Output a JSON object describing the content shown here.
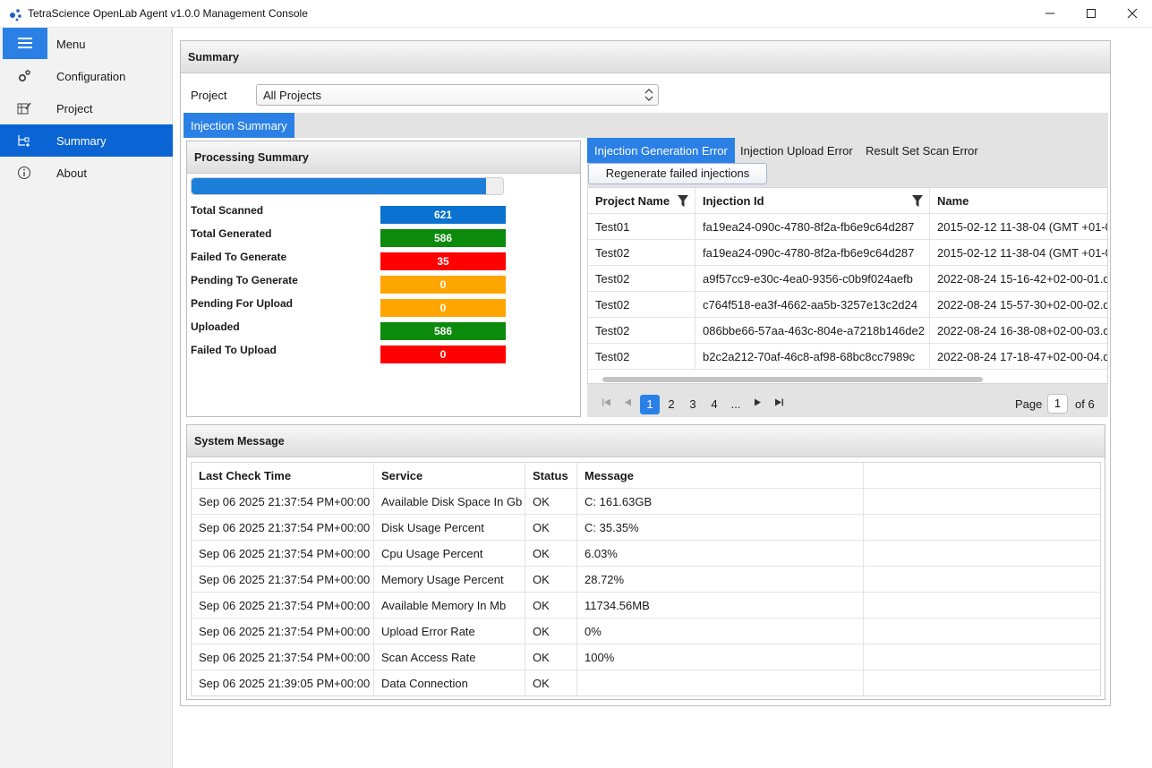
{
  "window": {
    "title": "TetraScience OpenLab Agent v1.0.0 Management Console"
  },
  "sidebar": {
    "items": [
      {
        "label": "Menu",
        "icon": "hamburger-menu-icon"
      },
      {
        "label": "Configuration",
        "icon": "gears-icon"
      },
      {
        "label": "Project",
        "icon": "edit-grid-icon"
      },
      {
        "label": "Summary",
        "icon": "summary-tree-icon",
        "active": true
      },
      {
        "label": "About",
        "icon": "info-icon"
      }
    ]
  },
  "summary": {
    "title": "Summary",
    "project_label": "Project",
    "project_value": "All Projects",
    "tab": "Injection Summary"
  },
  "processing": {
    "title": "Processing Summary",
    "progress_fraction": 0.945,
    "stats": [
      {
        "label": "Total Scanned",
        "value": "621",
        "color": "#0a72d0"
      },
      {
        "label": "Total Generated",
        "value": "586",
        "color": "#0b8a0b"
      },
      {
        "label": "Failed To Generate",
        "value": "35",
        "color": "#ff0000"
      },
      {
        "label": "Pending To Generate",
        "value": "0",
        "color": "#ffa500"
      },
      {
        "label": "Pending For Upload",
        "value": "0",
        "color": "#ffa500"
      },
      {
        "label": "Uploaded",
        "value": "586",
        "color": "#0b8a0b"
      },
      {
        "label": "Failed To Upload",
        "value": "0",
        "color": "#ff0000"
      }
    ]
  },
  "errors": {
    "tabs": [
      "Injection Generation Error",
      "Injection Upload Error",
      "Result Set Scan Error"
    ],
    "regenerate_label": "Regenerate failed injections",
    "columns": [
      "Project Name",
      "Injection Id",
      "Name"
    ],
    "rows": [
      [
        "Test01",
        "fa19ea24-090c-4780-8f2a-fb6e9c64d287",
        "2015-02-12 11-38-04 (GMT +01-0"
      ],
      [
        "Test02",
        "fa19ea24-090c-4780-8f2a-fb6e9c64d287",
        "2015-02-12 11-38-04 (GMT +01-0"
      ],
      [
        "Test02",
        "a9f57cc9-e30c-4ea0-9356-c0b9f024aefb",
        "2022-08-24 15-16-42+02-00-01.d"
      ],
      [
        "Test02",
        "c764f518-ea3f-4662-aa5b-3257e13c2d24",
        "2022-08-24 15-57-30+02-00-02.d"
      ],
      [
        "Test02",
        "086bbe66-57aa-463c-804e-a7218b146de2",
        "2022-08-24 16-38-08+02-00-03.d"
      ],
      [
        "Test02",
        "b2c2a212-70af-46c8-af98-68bc8cc7989c",
        "2022-08-24 17-18-47+02-00-04.d"
      ]
    ],
    "pager": {
      "pages": [
        "1",
        "2",
        "3",
        "4",
        "..."
      ],
      "current": "1",
      "page_label": "Page",
      "page_input": "1",
      "of_label": "of 6"
    }
  },
  "system": {
    "title": "System Message",
    "columns": [
      "Last Check Time",
      "Service",
      "Status",
      "Message",
      ""
    ],
    "rows": [
      [
        "Sep 06 2025 21:37:54 PM+00:00",
        "Available Disk Space In Gb",
        "OK",
        "C: 161.63GB",
        ""
      ],
      [
        "Sep 06 2025 21:37:54 PM+00:00",
        "Disk Usage Percent",
        "OK",
        "C: 35.35%",
        ""
      ],
      [
        "Sep 06 2025 21:37:54 PM+00:00",
        "Cpu Usage Percent",
        "OK",
        "6.03%",
        ""
      ],
      [
        "Sep 06 2025 21:37:54 PM+00:00",
        "Memory Usage Percent",
        "OK",
        "28.72%",
        ""
      ],
      [
        "Sep 06 2025 21:37:54 PM+00:00",
        "Available Memory In Mb",
        "OK",
        "11734.56MB",
        ""
      ],
      [
        "Sep 06 2025 21:37:54 PM+00:00",
        "Upload Error Rate",
        "OK",
        "0%",
        ""
      ],
      [
        "Sep 06 2025 21:37:54 PM+00:00",
        "Scan Access Rate",
        "OK",
        "100%",
        ""
      ],
      [
        "Sep 06 2025 21:39:05 PM+00:00",
        "Data Connection",
        "OK",
        "",
        ""
      ]
    ]
  }
}
